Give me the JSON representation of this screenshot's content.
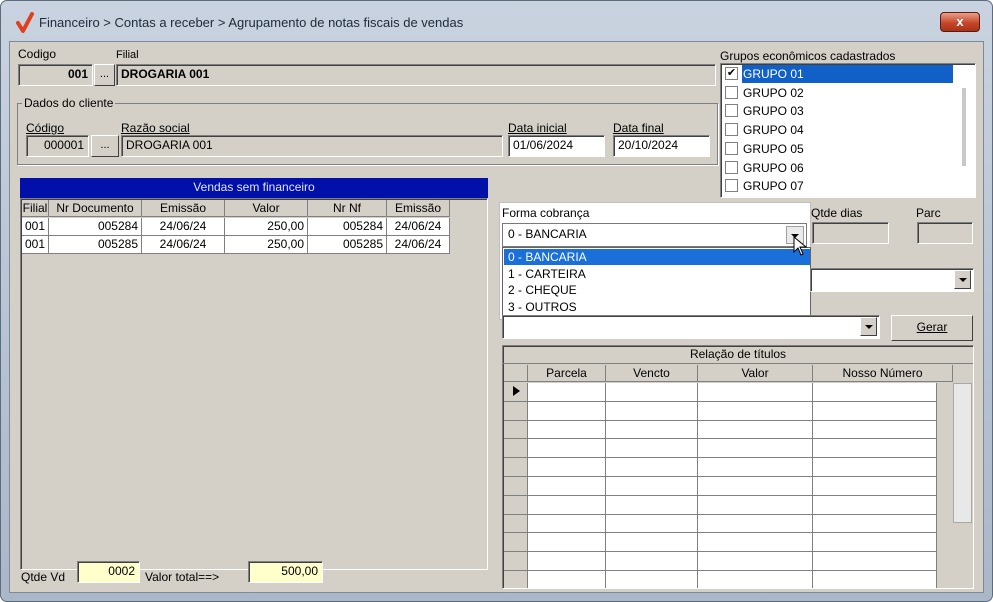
{
  "window": {
    "title": "Financeiro > Contas a receber > Agrupamento de notas fiscais de vendas",
    "close_label": "x"
  },
  "header": {
    "codigo_label": "Codigo",
    "codigo_value": "001",
    "ellipsis": "...",
    "filial_label": "Filial",
    "filial_value": "DROGARIA 001"
  },
  "cliente": {
    "group_title": "Dados do cliente",
    "codigo_label": "Código",
    "codigo_value": "000001",
    "razao_label": "Razão social",
    "razao_value": "DROGARIA 001",
    "data_inicial_label": "Data inicial",
    "data_inicial_value": "01/06/2024",
    "data_final_label": "Data final",
    "data_final_value": "20/10/2024"
  },
  "grupos": {
    "title": "Grupos econômicos cadastrados",
    "items": [
      {
        "label": "GRUPO 01",
        "checked": true
      },
      {
        "label": "GRUPO 02",
        "checked": false
      },
      {
        "label": "GRUPO 03",
        "checked": false
      },
      {
        "label": "GRUPO 04",
        "checked": false
      },
      {
        "label": "GRUPO 05",
        "checked": false
      },
      {
        "label": "GRUPO 06",
        "checked": false
      },
      {
        "label": "GRUPO 07",
        "checked": false
      }
    ]
  },
  "vendas": {
    "title": "Vendas sem financeiro",
    "columns": [
      "Filial",
      "Nr Documento",
      "Emissão",
      "Valor",
      "Nr Nf",
      "Emissão"
    ],
    "rows": [
      [
        "001",
        "005284",
        "24/06/24",
        "250,00",
        "005284",
        "24/06/24"
      ],
      [
        "001",
        "005285",
        "24/06/24",
        "250,00",
        "005285",
        "24/06/24"
      ]
    ],
    "qtde_label": "Qtde Vd",
    "qtde_value": "0002",
    "total_label": "Valor total==>",
    "total_value": "500,00"
  },
  "cobranca": {
    "label": "Forma cobrança",
    "selected": "0 - BANCARIA",
    "options": [
      "0 - BANCARIA",
      "1 - CARTEIRA",
      "2 - CHEQUE",
      "3 - OUTROS"
    ],
    "qtde_dias_label": "Qtde dias",
    "parc_label": "Parc"
  },
  "gerar_label": "Gerar",
  "titulos": {
    "title": "Relação de títulos",
    "columns": [
      "Parcela",
      "Vencto",
      "Valor",
      "Nosso Número"
    ]
  }
}
